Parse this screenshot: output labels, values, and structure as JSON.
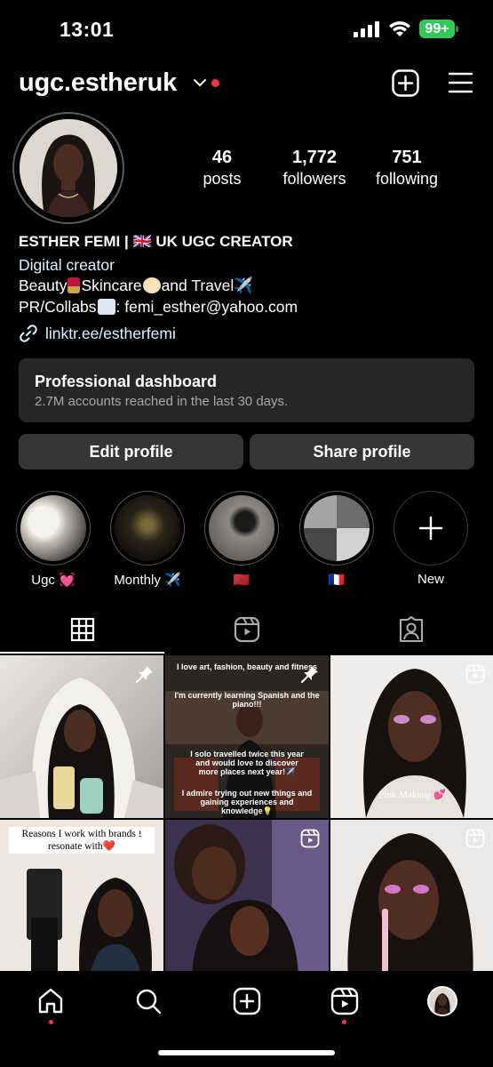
{
  "status_bar": {
    "time": "13:01",
    "battery": "99+"
  },
  "header": {
    "username": "ugc.estheruk"
  },
  "stats": [
    {
      "value": "46",
      "label": "posts"
    },
    {
      "value": "1,772",
      "label": "followers"
    },
    {
      "value": "751",
      "label": "following"
    }
  ],
  "bio": {
    "name": "ESTHER FEMI | 🇬🇧 UK UGC CREATOR",
    "category": "Digital creator",
    "line2_a": "Beauty",
    "line2_b": "Skincare",
    "line2_c": "and Travel✈️",
    "line3_a": "PR/Collabs",
    "line3_b": ": femi_esther@yahoo.com",
    "link": "linktr.ee/estherfemi"
  },
  "dashboard": {
    "title": "Professional dashboard",
    "subtitle": "2.7M accounts reached in the last 30 days."
  },
  "buttons": {
    "edit": "Edit profile",
    "share": "Share profile"
  },
  "highlights": [
    {
      "label": "Ugc 💓"
    },
    {
      "label": "Monthly ✈️"
    },
    {
      "label": "🇲🇦"
    },
    {
      "label": "🇫🇷"
    },
    {
      "label": "New"
    }
  ],
  "grid": {
    "tile2_caption_top": "I love art, fashion, beauty and fitness",
    "tile2_caption_2": "I'm currently learning Spanish and the piano!!!",
    "tile2_caption_3": "I solo travelled twice this year and would love to discover more places next year!✈️",
    "tile2_caption_4": "I admire trying out new things and gaining experiences and knowledge💡",
    "tile3_caption": "Pink Makeup 💕",
    "tile4_caption": "Reasons I work with brands I resonate with❤️"
  },
  "colors": {
    "accent_red": "#ff3040",
    "link_blue": "#e0f1ff",
    "battery_green": "#34c759",
    "card_bg": "#262626",
    "button_bg": "#363636"
  }
}
